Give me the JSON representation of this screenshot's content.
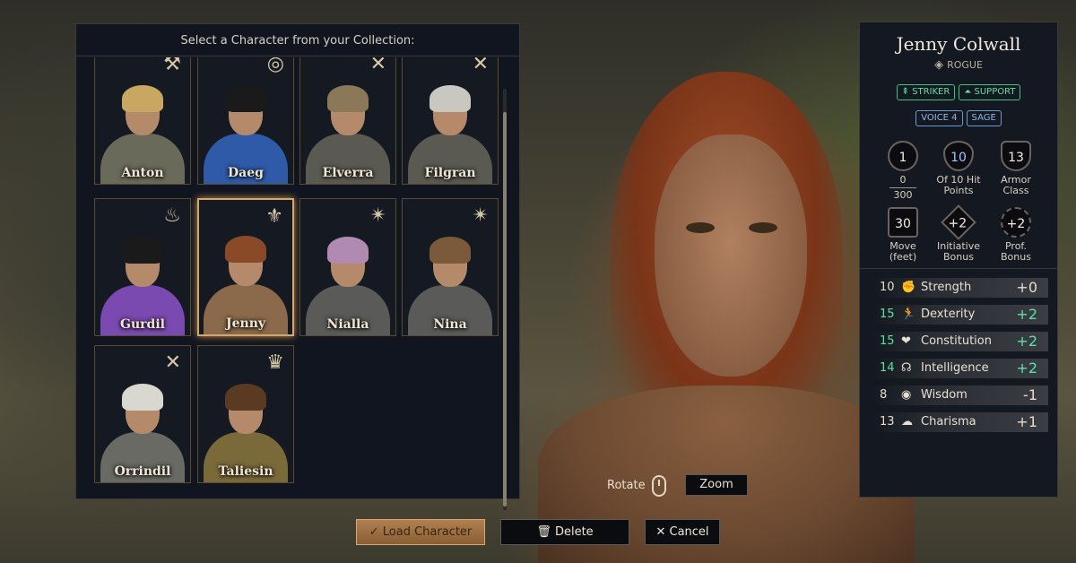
{
  "collection": {
    "title": "Select a Character from your Collection:",
    "characters": [
      {
        "name": "Anton",
        "class_icon": "fighter-icon",
        "glyph": "⚒",
        "hair": "#c8a860",
        "outfit": "#6a6a5a",
        "selected": false
      },
      {
        "name": "Daeg",
        "class_icon": "ranger-icon",
        "glyph": "◎",
        "hair": "#1a1a1a",
        "outfit": "#2e5aa8",
        "selected": false
      },
      {
        "name": "Elverra",
        "class_icon": "barbarian-icon",
        "glyph": "✕",
        "hair": "#8a7858",
        "outfit": "#5a5a52",
        "selected": false
      },
      {
        "name": "Filgran",
        "class_icon": "barbarian-icon",
        "glyph": "✕",
        "hair": "#c8c8c0",
        "outfit": "#5a5a52",
        "selected": false
      },
      {
        "name": "Gurdil",
        "class_icon": "sorcerer-icon",
        "glyph": "♨",
        "hair": "#1a1a1a",
        "outfit": "#7a4ab0",
        "selected": false
      },
      {
        "name": "Jenny",
        "class_icon": "rogue-icon",
        "glyph": "⚜",
        "hair": "#8a4a28",
        "outfit": "#8a6a4a",
        "selected": true
      },
      {
        "name": "Nialla",
        "class_icon": "cleric-icon",
        "glyph": "✴",
        "hair": "#b08ab0",
        "outfit": "#5a5a58",
        "selected": false
      },
      {
        "name": "Nina",
        "class_icon": "cleric-icon",
        "glyph": "✴",
        "hair": "#7a5a3a",
        "outfit": "#5a5a58",
        "selected": false
      },
      {
        "name": "Orrindil",
        "class_icon": "barbarian-icon",
        "glyph": "✕",
        "hair": "#d8d8d0",
        "outfit": "#6a6a64",
        "selected": false
      },
      {
        "name": "Taliesin",
        "class_icon": "bard-icon",
        "glyph": "♛",
        "hair": "#5a3a22",
        "outfit": "#7a6a3a",
        "selected": false
      }
    ]
  },
  "info": {
    "name": "Jenny Colwall",
    "class": "ROGUE",
    "class_icon": "rogue-icon",
    "roles": [
      {
        "label": "STRIKER",
        "icon": "striker-icon",
        "glyph": "⇞"
      },
      {
        "label": "SUPPORT",
        "icon": "support-icon",
        "glyph": "⏶"
      }
    ],
    "extras": [
      "VOICE 4",
      "SAGE"
    ],
    "stats": {
      "xp_level": "1",
      "xp_current": "0",
      "xp_next": "300",
      "hp": "10",
      "hp_label": "Of 10 Hit Points",
      "ac": "13",
      "ac_label": "Armor Class",
      "move": "30",
      "move_label": "Move (feet)",
      "initiative": "+2",
      "initiative_label": "Initiative Bonus",
      "proficiency": "+2",
      "proficiency_label": "Prof. Bonus"
    },
    "abilities": [
      {
        "score": "10",
        "name": "Strength",
        "mod": "+0",
        "icon": "fist-icon",
        "glyph": "✊",
        "boost": false
      },
      {
        "score": "15",
        "name": "Dexterity",
        "mod": "+2",
        "icon": "runner-icon",
        "glyph": "🏃",
        "boost": true
      },
      {
        "score": "15",
        "name": "Constitution",
        "mod": "+2",
        "icon": "heart-icon",
        "glyph": "❤",
        "boost": true
      },
      {
        "score": "14",
        "name": "Intelligence",
        "mod": "+2",
        "icon": "brain-icon",
        "glyph": "☊",
        "boost": true
      },
      {
        "score": "8",
        "name": "Wisdom",
        "mod": "-1",
        "icon": "eye-icon",
        "glyph": "◉",
        "boost": false
      },
      {
        "score": "13",
        "name": "Charisma",
        "mod": "+1",
        "icon": "speech-icon",
        "glyph": "☁",
        "boost": false
      }
    ]
  },
  "controls": {
    "rotate_label": "Rotate",
    "zoom_label": "Zoom",
    "load_label": "Load Character",
    "delete_label": "Delete",
    "cancel_label": "Cancel"
  }
}
